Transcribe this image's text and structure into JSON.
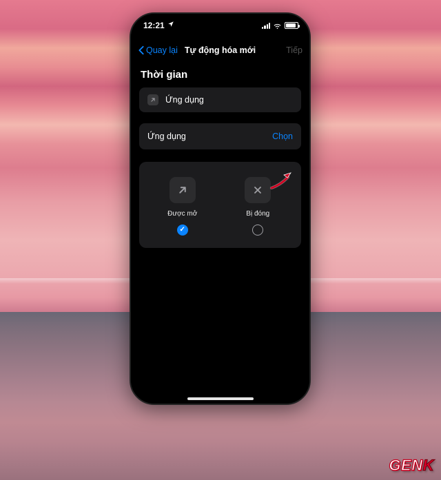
{
  "status": {
    "time": "12:21"
  },
  "nav": {
    "back": "Quay lại",
    "title": "Tự động hóa mới",
    "next": "Tiếp"
  },
  "section": {
    "title": "Thời gian"
  },
  "appCell": {
    "label": "Ứng dụng"
  },
  "chooseRow": {
    "label": "Ứng dụng",
    "action": "Chọn"
  },
  "options": {
    "open": {
      "label": "Được mở",
      "selected": true
    },
    "close": {
      "label": "Bị đóng",
      "selected": false
    }
  },
  "watermark": {
    "brand": "GEN",
    "accent": "K"
  }
}
